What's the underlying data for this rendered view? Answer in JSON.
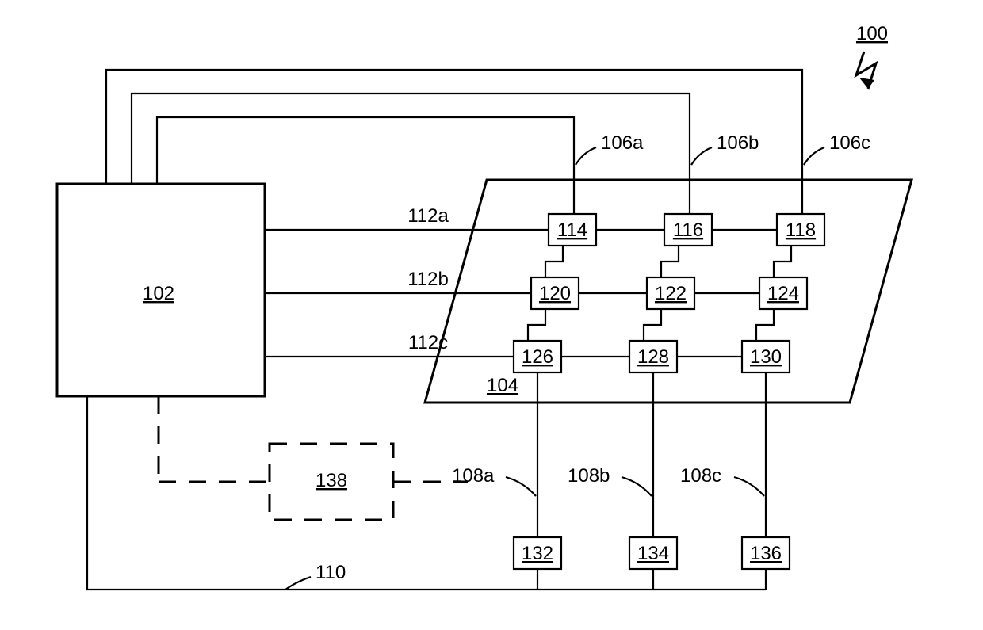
{
  "figure_label": "100",
  "controller_block": "102",
  "panel_label": "104",
  "aux_block": "138",
  "col_labels": {
    "a": "106a",
    "b": "106b",
    "c": "106c"
  },
  "row_labels": {
    "a": "112a",
    "b": "112b",
    "c": "112c"
  },
  "bottom_labels": {
    "a": "108a",
    "b": "108b",
    "c": "108c"
  },
  "feedback_label": "110",
  "grid": {
    "r1c1": "114",
    "r1c2": "116",
    "r1c3": "118",
    "r2c1": "120",
    "r2c2": "122",
    "r2c3": "124",
    "r3c1": "126",
    "r3c2": "128",
    "r3c3": "130"
  },
  "sinks": {
    "a": "132",
    "b": "134",
    "c": "136"
  }
}
